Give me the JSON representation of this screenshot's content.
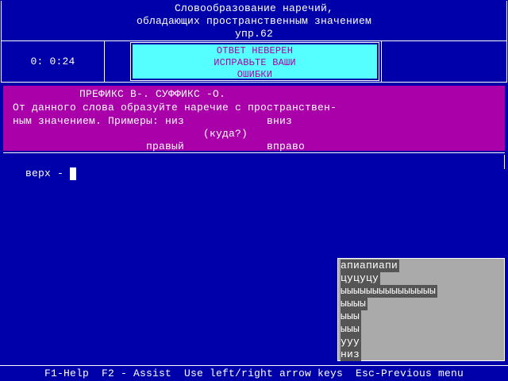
{
  "header": {
    "lines": [
      "Словообразование наречий,",
      "обладающих пространственным значением",
      "упр.62"
    ]
  },
  "timer": "0: 0:24",
  "message": {
    "lines": [
      "ОТВЕТ НЕВЕРЕН",
      "ИСПРАВЬТЕ ВАШИ",
      "ОШИБКИ"
    ]
  },
  "task": {
    "title": "ПРЕФИКС В-. СУФФИКС -О.",
    "line1": "От данного слова образуйте наречие с пространствен-",
    "line2a": "ным значением. Примеры: низ",
    "line2b": "вниз",
    "question": "(куда?)",
    "ex_a": "правый",
    "ex_b": "вправо"
  },
  "input": {
    "prompt": "верх -",
    "value": ""
  },
  "answers": [
    "апиапиапи",
    "цуцуцу",
    "ыыыыыыыыыыыыыыы",
    "ыыыы",
    "ыыы",
    "ыыы",
    "ууу",
    "низ"
  ],
  "footer": "F1-Help  F2 - Assist  Use left/right arrow keys  Esc-Previous menu",
  "colors": {
    "background": "#0000aa",
    "task": "#aa00aa",
    "message": "#55ffff",
    "list": "#aaaaaa"
  }
}
